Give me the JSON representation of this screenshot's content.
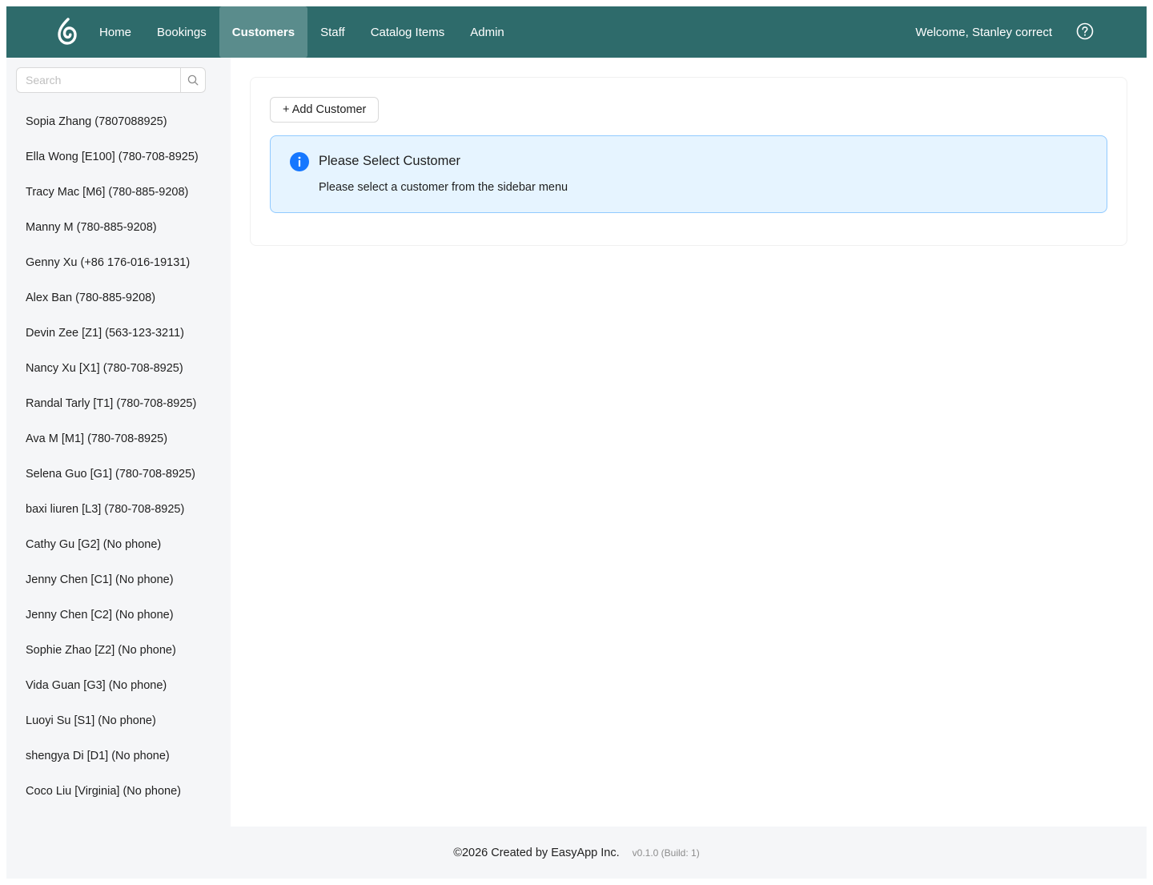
{
  "colors": {
    "header_bg": "#2e6b6b",
    "nav_active_bg": "#5a8c8c",
    "info_blue": "#1677ff",
    "alert_bg": "#e6f4ff",
    "alert_border": "#91caff"
  },
  "header": {
    "logo_icon": "flame-logo-icon",
    "nav": [
      {
        "label": "Home"
      },
      {
        "label": "Bookings"
      },
      {
        "label": "Customers",
        "active": true
      },
      {
        "label": "Staff"
      },
      {
        "label": "Catalog Items"
      },
      {
        "label": "Admin"
      }
    ],
    "welcome": "Welcome, Stanley correct",
    "help_icon": "question-circle-icon"
  },
  "sidebar": {
    "search": {
      "placeholder": "Search",
      "value": "",
      "icon": "search-icon"
    },
    "customers": [
      "Sopia Zhang (7807088925)",
      "Ella Wong [E100] (780-708-8925)",
      "Tracy Mac [M6] (780-885-9208)",
      "Manny M (780-885-9208)",
      "Genny Xu (+86 176-016-19131)",
      "Alex Ban (780-885-9208)",
      "Devin Zee [Z1] (563-123-3211)",
      "Nancy Xu [X1] (780-708-8925)",
      "Randal Tarly [T1] (780-708-8925)",
      "Ava M [M1] (780-708-8925)",
      "Selena Guo [G1] (780-708-8925)",
      "baxi liuren [L3] (780-708-8925)",
      "Cathy Gu [G2] (No phone)",
      "Jenny Chen [C1] (No phone)",
      "Jenny Chen [C2] (No phone)",
      "Sophie Zhao [Z2] (No phone)",
      "Vida Guan [G3] (No phone)",
      "Luoyi Su [S1] (No phone)",
      "shengya Di [D1] (No phone)",
      "Coco Liu [Virginia] (No phone)"
    ]
  },
  "main": {
    "add_button": "+ Add Customer",
    "alert": {
      "icon": "info-circle-icon",
      "title": "Please Select Customer",
      "description": "Please select a customer from the sidebar menu"
    }
  },
  "footer": {
    "copyright": "©2026 Created by EasyApp Inc.",
    "version": "v0.1.0 (Build: 1)"
  }
}
